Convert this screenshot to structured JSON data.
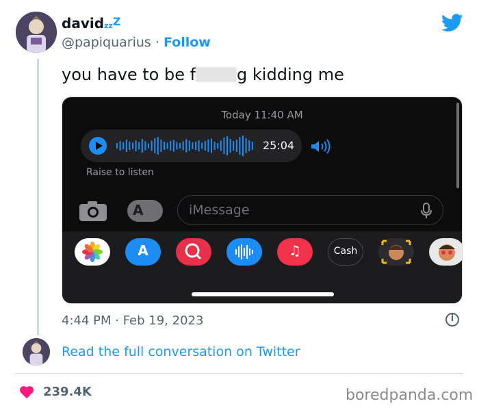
{
  "tweet": {
    "author_name": "david",
    "name_sleep_small": "zz",
    "name_sleep_big": "Z",
    "handle": "@papiquarius",
    "separator": " · ",
    "follow_label": "Follow",
    "text_before": "you have to be f",
    "text_after": "g kidding me",
    "timestamp": "4:44 PM · Feb 19, 2023",
    "info_glyph": "i",
    "read_conversation": "Read the full conversation on Twitter",
    "likes": "239.4K"
  },
  "screenshot": {
    "date_label": "Today",
    "time_label": "11:40 AM",
    "audio_duration": "25:04",
    "raise_hint": "Raise to listen",
    "imessage_placeholder": "iMessage",
    "apps_glyph": "A",
    "cash_label": "Cash",
    "tray_apps": [
      {
        "name": "photos-icon",
        "color": "#ffffff"
      },
      {
        "name": "app-store-icon",
        "color": "#1d8df6"
      },
      {
        "name": "web-search-icon",
        "color": "#e8304a"
      },
      {
        "name": "audio-message-icon",
        "color": "#1d8df6"
      },
      {
        "name": "music-icon",
        "color": "#f2324a"
      },
      {
        "name": "apple-cash-icon",
        "color": "#1c1c1e"
      },
      {
        "name": "memoji-icon",
        "color": "#f3b91a"
      },
      {
        "name": "memoji-stickers-icon",
        "color": "#e8e8e8"
      }
    ]
  },
  "colors": {
    "twitter_blue": "#1d9bf0",
    "heart": "#f91880",
    "muted": "#536471"
  },
  "watermark": "boredpanda.com"
}
